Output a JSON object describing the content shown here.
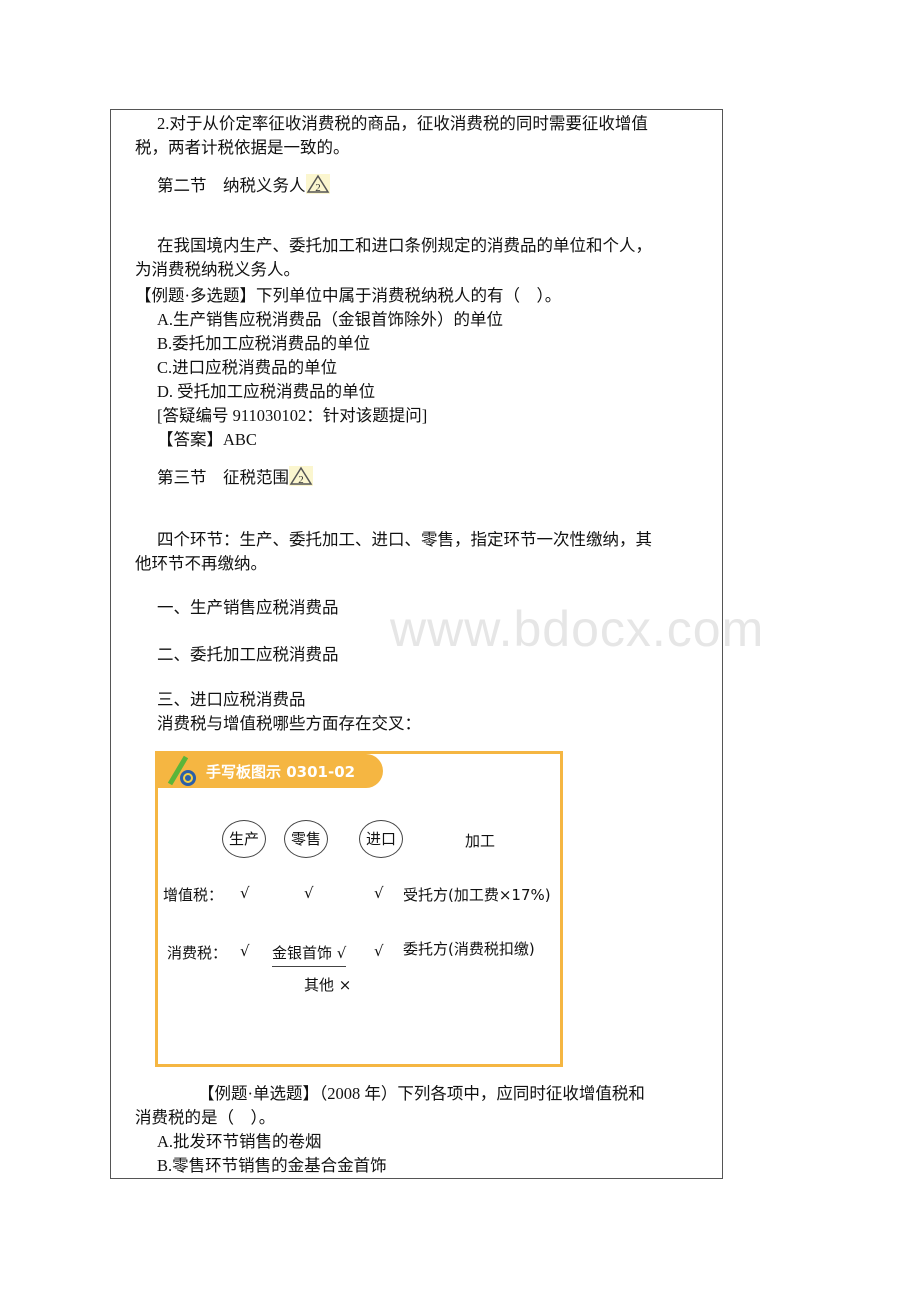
{
  "watermark": "www.bdocx.com",
  "lines": {
    "l1": "2.对于从价定率征收消费税的商品，征收消费税的同时需要征收增值",
    "l2": "税，两者计税依据是一致的。",
    "sec2": "第二节　纳税义务人",
    "p1a": "在我国境内生产、委托加工和进口条例规定的消费品的单位和个人，",
    "p1b": "为消费税纳税义务人。",
    "q1": "【例题·多选题】下列单位中属于消费税纳税人的有（　）。",
    "q1a": "A.生产销售应税消费品（金银首饰除外）的单位",
    "q1b": "B.委托加工应税消费品的单位",
    "q1c": "C.进口应税消费品的单位",
    "q1d": "D. 受托加工应税消费品的单位",
    "q1ref": "[答疑编号 911030102：针对该题提问]",
    "q1ans": "【答案】ABC",
    "sec3": "第三节　征税范围",
    "p2a": "四个环节：生产、委托加工、进口、零售，指定环节一次性缴纳，其",
    "p2b": "他环节不再缴纳。",
    "i1": "一、生产销售应税消费品",
    "i2": "二、委托加工应税消费品",
    "i3": "三、进口应税消费品",
    "p3": "消费税与增值税哪些方面存在交叉：",
    "q2a": "【例题·单选题】（2008 年）下列各项中，应同时征收增值税和",
    "q2b": "消费税的是（　）。",
    "q2oa": "A.批发环节销售的卷烟",
    "q2ob": "B.零售环节销售的金基合金首饰"
  },
  "level_badge": "2",
  "board": {
    "title": "手写板图示 0301-02",
    "accent": "#f5b642",
    "cols": [
      "生产",
      "零售",
      "进口",
      "加工"
    ],
    "vat_label": "增值税：",
    "ct_label": "消费税：",
    "check": "√",
    "vat_processing": "受托方(加工费×17%)",
    "ct_retail_top": "金银首饰 √",
    "ct_retail_bottom": "其他 ×",
    "ct_processing": "委托方(消费税扣缴)"
  }
}
